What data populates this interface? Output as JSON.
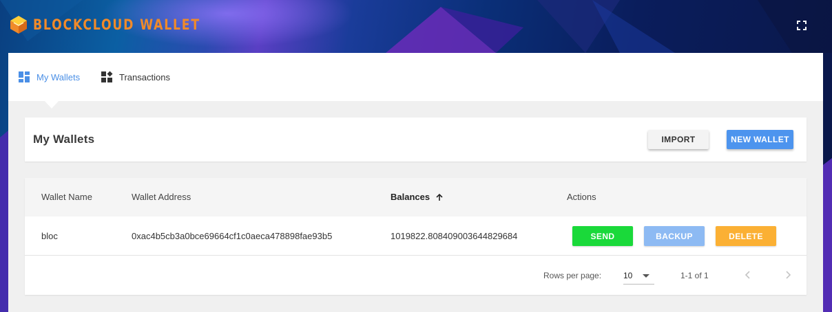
{
  "app": {
    "title": "BLOCKCLOUD WALLET"
  },
  "header": {
    "logo_icon": "cube-logo-icon",
    "fullscreen_icon": "fullscreen-icon"
  },
  "nav": {
    "items": [
      {
        "label": "My Wallets",
        "icon": "dashboard-icon",
        "active": true
      },
      {
        "label": "Transactions",
        "icon": "widgets-icon",
        "active": false
      }
    ]
  },
  "page": {
    "title": "My Wallets",
    "import_label": "IMPORT",
    "new_wallet_label": "NEW WALLET"
  },
  "table": {
    "columns": [
      "Wallet Name",
      "Wallet Address",
      "Balances",
      "Actions"
    ],
    "sorted_column": "Balances",
    "sort_direction": "ascending",
    "rows": [
      {
        "name": "bloc",
        "address": "0xac4b5cb3a0bce69664cf1c0aeca478898fae93b5",
        "balance": "1019822.808409003644829684",
        "actions": [
          "SEND",
          "BACKUP",
          "DELETE"
        ]
      }
    ],
    "pagination": {
      "rows_per_page_label": "Rows per page:",
      "rows_per_page": "10",
      "range": "1-1 of 1"
    }
  },
  "colors": {
    "brand_orange": "#f08a2a",
    "accent_blue": "#4d94ee",
    "send_green": "#1ad93a",
    "backup_blue": "#8dbaf3",
    "delete_orange": "#fbb034"
  }
}
